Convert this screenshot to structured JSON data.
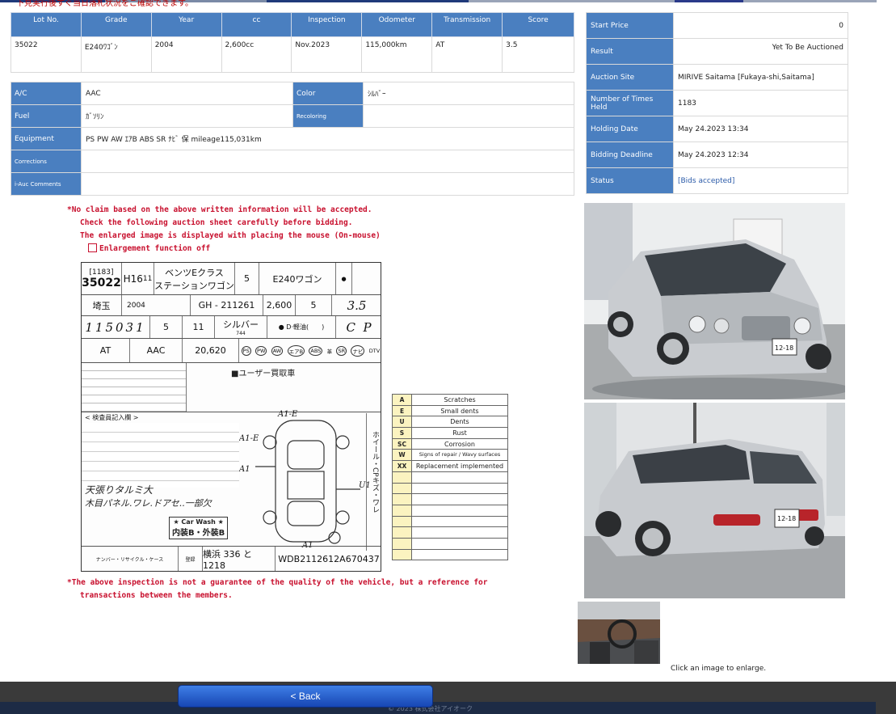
{
  "top_cut_text": "下見実行後すぐ当日落札状況をご確認できます。",
  "spec": {
    "headers": [
      "Lot No.",
      "Grade",
      "Year",
      "cc",
      "Inspection",
      "Odometer",
      "Transmission",
      "Score"
    ],
    "values": [
      "35022",
      "E240ﾜｺﾞﾝ",
      "2004",
      "2,600cc",
      "Nov.2023",
      "115,000km",
      "AT",
      "3.5"
    ]
  },
  "detail": {
    "ac_label": "A/C",
    "ac_value": "AAC",
    "color_label": "Color",
    "color_value": "ｼﾙﾊﾞｰ",
    "fuel_label": "Fuel",
    "fuel_value": "ｶﾞｿﾘﾝ",
    "recoloring_label": "Recoloring",
    "recoloring_value": "",
    "equipment_label": "Equipment",
    "equipment_value": "PS PW AW ｴｱB ABS SR ﾅﾋﾞ 保 mileage115,031km",
    "corrections_label": "Corrections",
    "corrections_value": "",
    "comments_label": "i-Auc Comments",
    "comments_value": ""
  },
  "side": {
    "start_price_label": "Start Price",
    "start_price": "0",
    "result_label": "Result",
    "result": "Yet To Be Auctioned",
    "site_label": "Auction Site",
    "site": "MIRIVE Saitama [Fukaya-shi,Saitama]",
    "times_label": "Number of Times Held",
    "times": "1183",
    "holding_label": "Holding Date",
    "holding": "May 24.2023 13:34",
    "deadline_label": "Bidding Deadline",
    "deadline": "May 24.2023 12:34",
    "status_label": "Status",
    "status": "[Bids accepted]"
  },
  "notices": {
    "line1": "*No claim based on the above written information will be accepted.",
    "line2": "Check the following auction sheet carefully before bidding.",
    "line3": "The enlarged image is displayed with placing the mouse (On-mouse)",
    "enlarge_toggle": "Enlargement function off",
    "bottom1": "*The above inspection is not a guarantee of the quality of the vehicle, but a reference for",
    "bottom2": "transactions between the members."
  },
  "sheet": {
    "times": "[1183]",
    "lot": "35022",
    "era": "H16",
    "month": "11",
    "name1": "ベンツEクラス",
    "name2": "ステーションワゴン",
    "doors": "5",
    "grade": "E240ワゴン",
    "region": "埼玉",
    "year": "2004",
    "model": "GH  -  211261",
    "cc": "2,600",
    "seats": "5",
    "score": "3.5",
    "mileage": "115031",
    "exp_year": "5",
    "exp_month": "11",
    "color": "シルバー",
    "color_code": "744",
    "trans": "AT",
    "ac": "AAC",
    "recycle": "20,620",
    "equip": [
      "PS",
      "PW",
      "AW",
      "エアB",
      "ABS",
      "革",
      "SR",
      "ナビ",
      "DTV"
    ],
    "note": "■ユーザー買取車",
    "inspector_title": "< 検査員記入欄 >",
    "hand_note1": "天張りタルミ大",
    "hand_note2": "木目パネル.ワレ.ドアセ..一部欠",
    "carwash": "★ Car Wash ★",
    "carwash_sub": "内装B・外装B",
    "plate": "横浜  336 と 1218",
    "vin": "WDB2112612A670437",
    "side_text": "ホイール・CPキズ・ワレ"
  },
  "legend": [
    {
      "code": "A",
      "desc": "Scratches"
    },
    {
      "code": "E",
      "desc": "Small dents"
    },
    {
      "code": "U",
      "desc": "Dents"
    },
    {
      "code": "S",
      "desc": "Rust"
    },
    {
      "code": "SC",
      "desc": "Corrosion"
    },
    {
      "code": "W",
      "desc": "Signs of repair / Wavy surfaces"
    },
    {
      "code": "XX",
      "desc": "Replacement implemented"
    }
  ],
  "photo_caption": "Click an image to enlarge.",
  "plate_text": "12-18",
  "back_label": "< Back",
  "copyright": "© 2023  株式会社アイオーク",
  "colors": {
    "header_blue": "#4a7fc0",
    "notice_red": "#c8102e",
    "link_blue": "#2a5aa8"
  }
}
